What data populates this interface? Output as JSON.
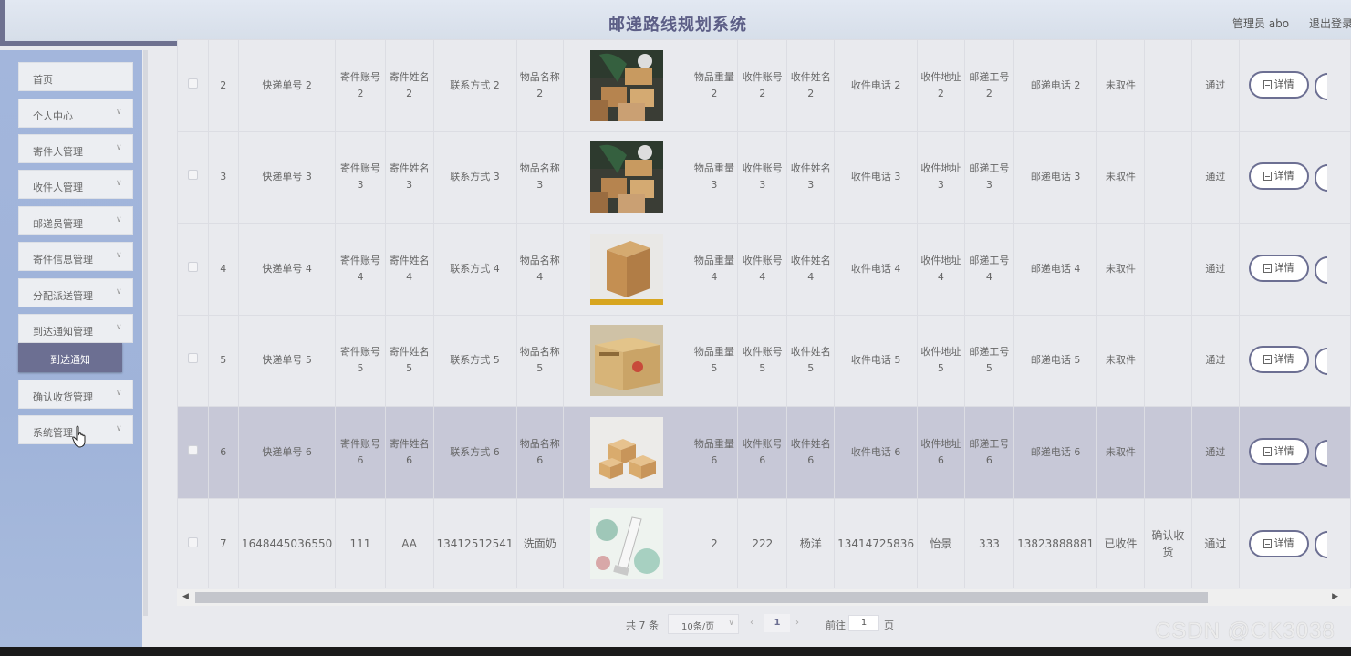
{
  "header": {
    "title": "邮递路线规划系统",
    "admin_label": "管理员 abo",
    "logout_label": "退出登录"
  },
  "sidebar": {
    "items": [
      {
        "label": "首页",
        "has_chevron": false
      },
      {
        "label": "个人中心",
        "has_chevron": true
      },
      {
        "label": "寄件人管理",
        "has_chevron": true
      },
      {
        "label": "收件人管理",
        "has_chevron": true
      },
      {
        "label": "邮递员管理",
        "has_chevron": true
      },
      {
        "label": "寄件信息管理",
        "has_chevron": true
      },
      {
        "label": "分配派送管理",
        "has_chevron": true
      },
      {
        "label": "到达通知管理",
        "has_chevron": true
      },
      {
        "label": "确认收货管理",
        "has_chevron": true
      },
      {
        "label": "系统管理",
        "has_chevron": true
      }
    ],
    "active_submenu": "到达通知"
  },
  "table": {
    "rows": [
      {
        "index": "2",
        "tracking": "快递单号 2",
        "sender_account": "寄件账号 2",
        "sender_name": "寄件姓名 2",
        "contact": "联系方式 2",
        "item_name": "物品名称 2",
        "image": "parcels-pile",
        "weight": "物品重量 2",
        "recv_account": "收件账号 2",
        "recv_name": "收件姓名 2",
        "recv_phone": "收件电话 2",
        "recv_address": "收件地址 2",
        "courier_id": "邮递工号 2",
        "courier_phone": "邮递电话 2",
        "pickup_status": "未取件",
        "confirm": "",
        "review": "通过",
        "detail": "详情",
        "highlight": false
      },
      {
        "index": "3",
        "tracking": "快递单号 3",
        "sender_account": "寄件账号 3",
        "sender_name": "寄件姓名 3",
        "contact": "联系方式 3",
        "item_name": "物品名称 3",
        "image": "parcels-pile",
        "weight": "物品重量 3",
        "recv_account": "收件账号 3",
        "recv_name": "收件姓名 3",
        "recv_phone": "收件电话 3",
        "recv_address": "收件地址 3",
        "courier_id": "邮递工号 3",
        "courier_phone": "邮递电话 3",
        "pickup_status": "未取件",
        "confirm": "",
        "review": "通过",
        "detail": "详情",
        "highlight": false
      },
      {
        "index": "4",
        "tracking": "快递单号 4",
        "sender_account": "寄件账号 4",
        "sender_name": "寄件姓名 4",
        "contact": "联系方式 4",
        "item_name": "物品名称 4",
        "image": "cardboard-box",
        "weight": "物品重量 4",
        "recv_account": "收件账号 4",
        "recv_name": "收件姓名 4",
        "recv_phone": "收件电话 4",
        "recv_address": "收件地址 4",
        "courier_id": "邮递工号 4",
        "courier_phone": "邮递电话 4",
        "pickup_status": "未取件",
        "confirm": "",
        "review": "通过",
        "detail": "详情",
        "highlight": false
      },
      {
        "index": "5",
        "tracking": "快递单号 5",
        "sender_account": "寄件账号 5",
        "sender_name": "寄件姓名 5",
        "contact": "联系方式 5",
        "item_name": "物品名称 5",
        "image": "labeled-box",
        "weight": "物品重量 5",
        "recv_account": "收件账号 5",
        "recv_name": "收件姓名 5",
        "recv_phone": "收件电话 5",
        "recv_address": "收件地址 5",
        "courier_id": "邮递工号 5",
        "courier_phone": "邮递电话 5",
        "pickup_status": "未取件",
        "confirm": "",
        "review": "通过",
        "detail": "详情",
        "highlight": false
      },
      {
        "index": "6",
        "tracking": "快递单号 6",
        "sender_account": "寄件账号 6",
        "sender_name": "寄件姓名 6",
        "contact": "联系方式 6",
        "item_name": "物品名称 6",
        "image": "small-boxes",
        "weight": "物品重量 6",
        "recv_account": "收件账号 6",
        "recv_name": "收件姓名 6",
        "recv_phone": "收件电话 6",
        "recv_address": "收件地址 6",
        "courier_id": "邮递工号 6",
        "courier_phone": "邮递电话 6",
        "pickup_status": "未取件",
        "confirm": "",
        "review": "通过",
        "detail": "详情",
        "highlight": true
      },
      {
        "index": "7",
        "tracking": "1648445036550",
        "sender_account": "111",
        "sender_name": "AA",
        "contact": "13412512541",
        "item_name": "洗面奶",
        "image": "cleanser-tube",
        "weight": "2",
        "recv_account": "222",
        "recv_name": "杨洋",
        "recv_phone": "13414725836",
        "recv_address": "怡景",
        "courier_id": "333",
        "courier_phone": "13823888881",
        "pickup_status": "已收件",
        "confirm": "确认收货",
        "review": "通过",
        "detail": "详情",
        "highlight": false
      }
    ]
  },
  "pagination": {
    "total": "共 7 条",
    "page_size": "10条/页",
    "current_page": "1",
    "goto_label": "前往",
    "goto_value": "1",
    "page_unit": "页"
  },
  "watermark": "CSDN @CK3038",
  "colors": {
    "accent": "#6c6f92",
    "title": "#5c5e86",
    "sidebar": "#a3b6dc",
    "highlight_row": "#c7c8d7"
  }
}
